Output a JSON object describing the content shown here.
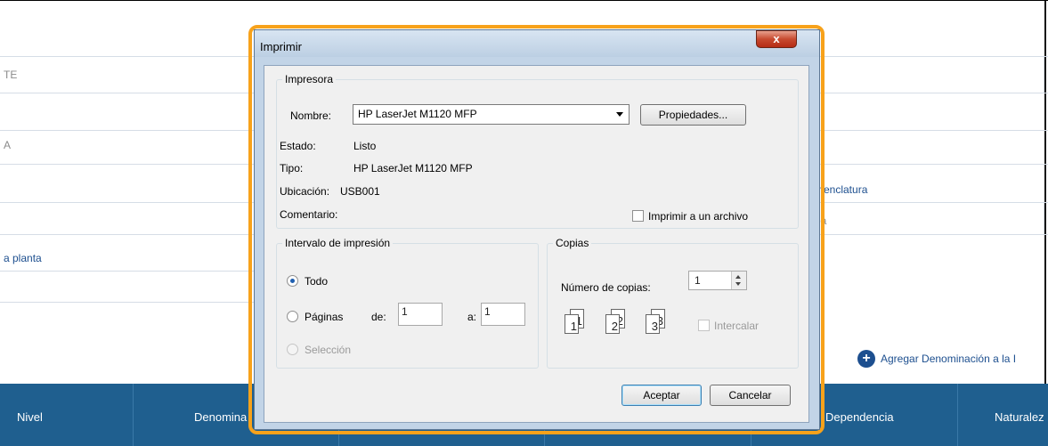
{
  "background": {
    "fields_left": [
      "TE",
      "A",
      "a planta"
    ],
    "fields_right": [
      "menclatura",
      "ba"
    ],
    "add_link": "Agregar Denominación a la I",
    "table_columns": [
      "Nivel",
      "Denomina",
      "Dependencia",
      "Naturalez"
    ]
  },
  "dialog": {
    "title": "Imprimir",
    "close_glyph": "x",
    "printer": {
      "legend": "Impresora",
      "name_label": "Nombre:",
      "name_value": "HP LaserJet M1120 MFP",
      "properties_button": "Propiedades...",
      "status_label": "Estado:",
      "status_value": "Listo",
      "type_label": "Tipo:",
      "type_value": "HP LaserJet M1120 MFP",
      "location_label": "Ubicación:",
      "location_value": "USB001",
      "comment_label": "Comentario:",
      "print_to_file": "Imprimir a un archivo"
    },
    "range": {
      "legend": "Intervalo de impresión",
      "all": "Todo",
      "pages": "Páginas",
      "from_label": "de:",
      "from_value": "1",
      "to_label": "a:",
      "to_value": "1",
      "selection": "Selección"
    },
    "copies": {
      "legend": "Copias",
      "count_label": "Número de copias:",
      "count_value": "1",
      "collate": "Intercalar",
      "collate_pages": [
        "1",
        "1",
        "2",
        "2",
        "3",
        "3"
      ]
    },
    "ok_button": "Aceptar",
    "cancel_button": "Cancelar"
  }
}
